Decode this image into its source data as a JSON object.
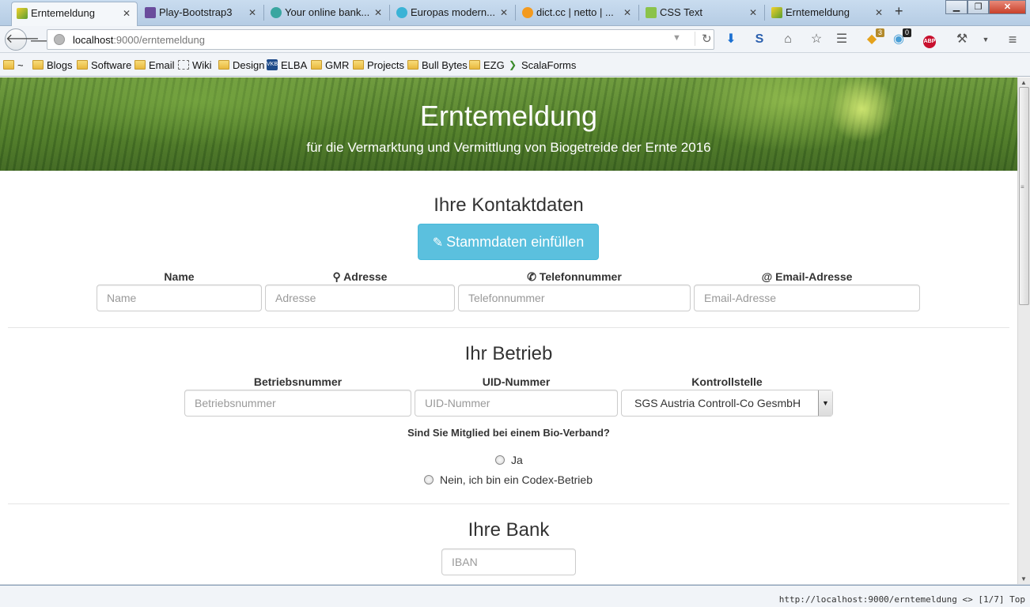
{
  "browser": {
    "tabs": [
      {
        "label": "Erntemeldung",
        "icon": "erntemeldung-favicon",
        "active": true
      },
      {
        "label": "Play-Bootstrap3",
        "icon": "play-favicon"
      },
      {
        "label": "Your online bank...",
        "icon": "bank-favicon"
      },
      {
        "label": "Europas modern...",
        "icon": "europa-favicon"
      },
      {
        "label": "dict.cc | netto | ...",
        "icon": "dictcc-favicon"
      },
      {
        "label": "CSS Text",
        "icon": "w3schools-favicon"
      },
      {
        "label": "Erntemeldung",
        "icon": "erntemeldung-favicon"
      }
    ],
    "new_tab": "+",
    "close_glyph": "✕",
    "url": {
      "host": "localhost",
      "rest": ":9000/erntemeldung"
    },
    "badges": {
      "tabs_count": "3",
      "notifications": "0",
      "adblock": "ABP"
    },
    "bookmarks": [
      {
        "label": "~",
        "icon": "folder-icon"
      },
      {
        "label": "Blogs",
        "icon": "folder-icon"
      },
      {
        "label": "Software",
        "icon": "folder-icon"
      },
      {
        "label": "Email",
        "icon": "folder-icon"
      },
      {
        "label": "Wiki",
        "icon": "dotted-page-icon"
      },
      {
        "label": "Design",
        "icon": "folder-icon"
      },
      {
        "label": "ELBA",
        "icon": "vkb-icon"
      },
      {
        "label": "GMR",
        "icon": "folder-icon"
      },
      {
        "label": "Projects",
        "icon": "folder-icon"
      },
      {
        "label": "Bull Bytes",
        "icon": "folder-icon"
      },
      {
        "label": "EZG",
        "icon": "folder-icon"
      },
      {
        "label": "ScalaForms",
        "icon": "play-icon"
      }
    ],
    "status_text": "http://localhost:9000/erntemeldung <> [1/7] Top"
  },
  "hero": {
    "title": "Erntemeldung",
    "subtitle": "für die Vermarktung und Vermittlung von Biogetreide der Ernte 2016"
  },
  "contact": {
    "heading": "Ihre Kontaktdaten",
    "prefill_button": "Stammdaten einfüllen",
    "fields": {
      "name": {
        "label": "Name",
        "placeholder": "Name"
      },
      "address": {
        "label": "Adresse",
        "placeholder": "Adresse",
        "icon": "map-marker-icon"
      },
      "phone": {
        "label": "Telefonnummer",
        "placeholder": "Telefonnummer",
        "icon": "phone-icon"
      },
      "email": {
        "label": "Email-Adresse",
        "placeholder": "Email-Adresse",
        "icon": "at-icon"
      }
    }
  },
  "business": {
    "heading": "Ihr Betrieb",
    "fields": {
      "number": {
        "label": "Betriebsnummer",
        "placeholder": "Betriebsnummer"
      },
      "uid": {
        "label": "UID-Nummer",
        "placeholder": "UID-Nummer"
      },
      "control": {
        "label": "Kontrollstelle",
        "value": "SGS Austria Controll-Co GesmbH"
      }
    },
    "question": "Sind Sie Mitglied bei einem Bio-Verband?",
    "options": [
      "Ja",
      "Nein, ich bin ein Codex-Betrieb"
    ]
  },
  "bank": {
    "heading": "Ihre Bank",
    "iban_placeholder": "IBAN"
  },
  "colors": {
    "info_button": "#5bc0de",
    "hero_green": "#4f7a2a"
  }
}
